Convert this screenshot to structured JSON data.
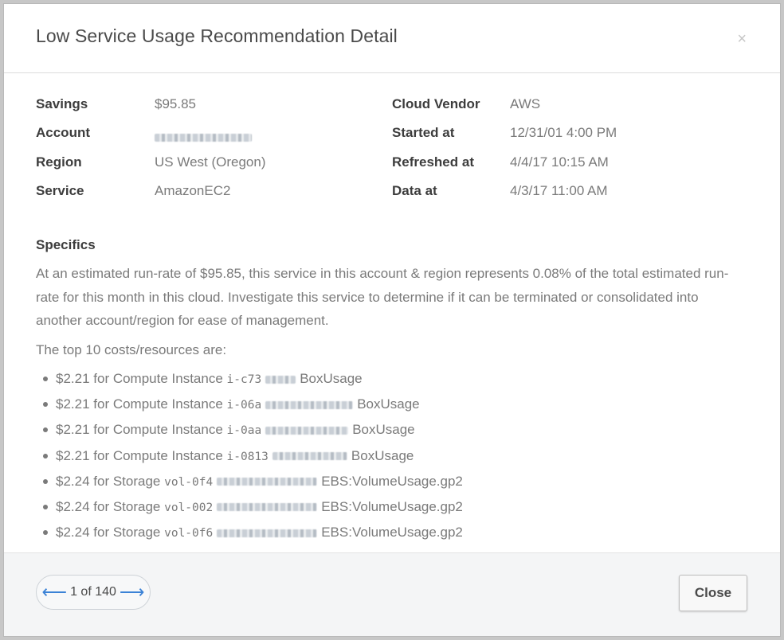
{
  "modal": {
    "title": "Low Service Usage Recommendation Detail",
    "close_icon": "×"
  },
  "details": {
    "left": [
      {
        "label": "Savings",
        "value": "$95.85"
      },
      {
        "label": "Account",
        "value": ""
      },
      {
        "label": "Region",
        "value": "US West (Oregon)"
      },
      {
        "label": "Service",
        "value": "AmazonEC2"
      }
    ],
    "right": [
      {
        "label": "Cloud Vendor",
        "value": "AWS"
      },
      {
        "label": "Started at",
        "value": "12/31/01 4:00 PM"
      },
      {
        "label": "Refreshed at",
        "value": "4/4/17 10:15 AM"
      },
      {
        "label": "Data at",
        "value": "4/3/17 11:00 AM"
      }
    ]
  },
  "specifics": {
    "title": "Specifics",
    "text": "At an estimated run-rate of $95.85, this service in this account & region represents 0.08% of the total estimated run-rate for this month in this cloud. Investigate this service to determine if it can be terminated or consolidated into another account/region for ease of management.",
    "top_label": "The top 10 costs/resources are:"
  },
  "costs": [
    {
      "prefix": "$2.21 for Compute Instance",
      "id": "i-c73",
      "suffix": "BoxUsage"
    },
    {
      "prefix": "$2.21 for Compute Instance",
      "id": "i-06a",
      "suffix": "BoxUsage"
    },
    {
      "prefix": "$2.21 for Compute Instance",
      "id": "i-0aa",
      "suffix": "BoxUsage"
    },
    {
      "prefix": "$2.21 for Compute Instance",
      "id": "i-0813",
      "suffix": "BoxUsage"
    },
    {
      "prefix": "$2.24 for Storage",
      "id": "vol-0f4",
      "suffix": "EBS:VolumeUsage.gp2"
    },
    {
      "prefix": "$2.24 for Storage",
      "id": "vol-002",
      "suffix": "EBS:VolumeUsage.gp2"
    },
    {
      "prefix": "$2.24 for Storage",
      "id": "vol-0f6",
      "suffix": "EBS:VolumeUsage.gp2"
    }
  ],
  "footer": {
    "pager_text": "1 of 140",
    "prev_icon": "⟵",
    "next_icon": "⟶",
    "close_label": "Close"
  }
}
